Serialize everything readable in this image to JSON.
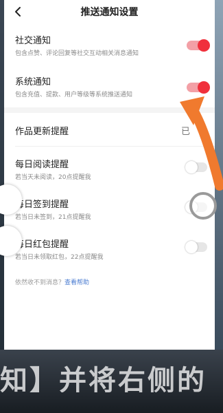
{
  "header": {
    "title": "推送通知设置"
  },
  "social": {
    "label": "社交通知",
    "desc": "包含点赞、评论回复等社交互动相关消息通知",
    "enabled": true
  },
  "system": {
    "label": "系统通知",
    "desc": "包含充值、提款、用户等级等系统推送通知",
    "enabled": true
  },
  "works_update": {
    "label": "作品更新提醒",
    "value_fragment": "已"
  },
  "daily_read": {
    "label": "每日阅读提醒",
    "desc": "若当天未阅读，20点提醒我",
    "enabled": false
  },
  "daily_checkin": {
    "label": "每日签到提醒",
    "desc": "若当日未签到，21点提醒我",
    "enabled": false
  },
  "daily_redpacket": {
    "label": "每日红包提醒",
    "desc": "若当日未领取红包，22点提醒我",
    "enabled": false
  },
  "help": {
    "text": "依然收不到消息？",
    "link": "查看帮助"
  },
  "caption": {
    "text": "知】并将右侧的"
  },
  "colors": {
    "accent": "#f0303c",
    "arrow": "#f07a2e",
    "link": "#4a7bd0"
  },
  "icons": {
    "back": "chevron-left-icon",
    "pointer": "arrow-curve-icon"
  }
}
